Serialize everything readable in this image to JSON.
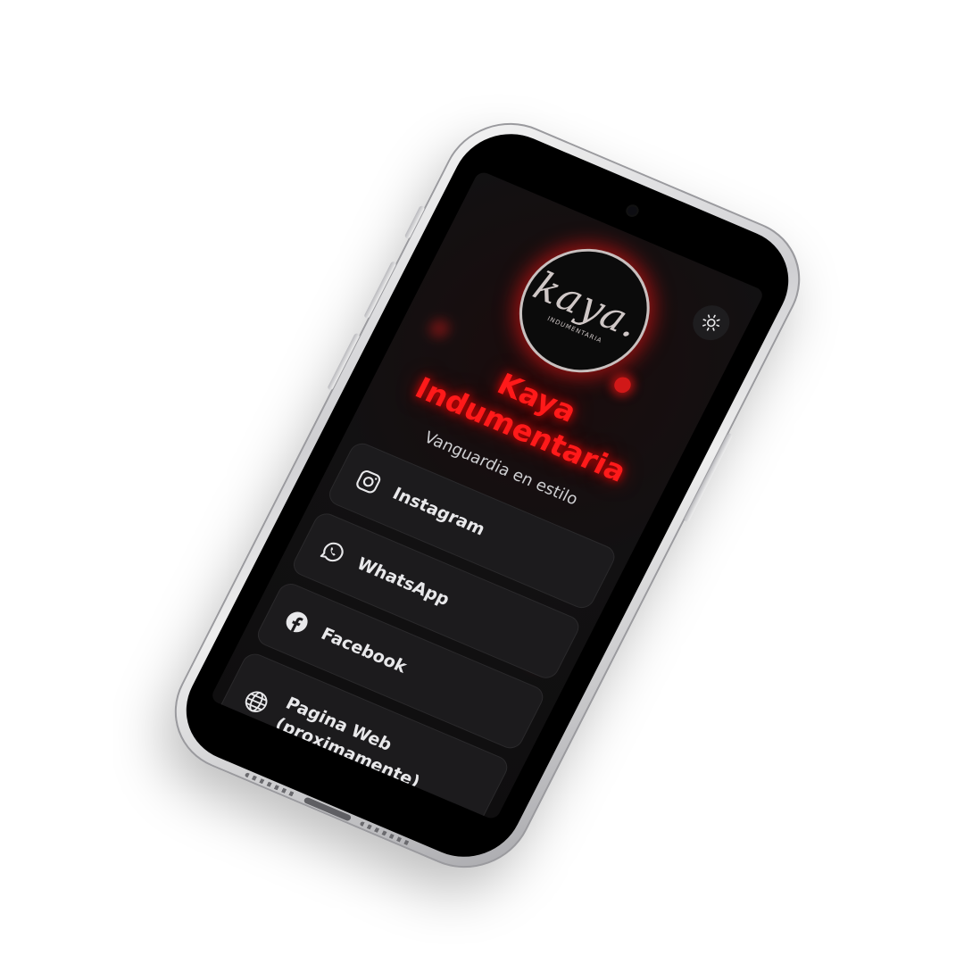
{
  "profile": {
    "logo_text": "kaya.",
    "logo_subtext": "INDUMENTARIA",
    "name_line1": "Kaya",
    "name_line2": "Indumentaria",
    "tagline": "Vanguardia en estilo"
  },
  "theme_toggle": {
    "icon": "sun-icon"
  },
  "links": [
    {
      "label": "Instagram",
      "icon": "instagram-icon"
    },
    {
      "label": "WhatsApp",
      "icon": "whatsapp-icon"
    },
    {
      "label": "Facebook",
      "icon": "facebook-icon"
    },
    {
      "label": "Pagina Web\n(proximamente)",
      "icon": "globe-icon"
    }
  ],
  "colors": {
    "accent": "#ff1a1a",
    "background": "#121112",
    "card": "#1c1b1d",
    "text": "#e8e8ea"
  }
}
